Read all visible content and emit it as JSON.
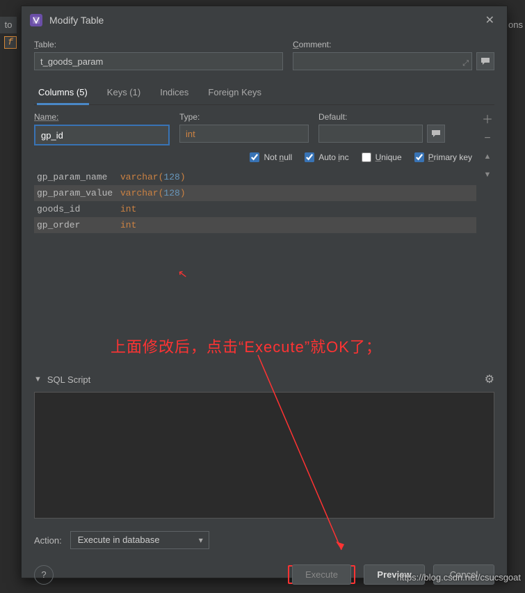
{
  "window": {
    "title": "Modify Table"
  },
  "table": {
    "label": "Table:",
    "value": "t_goods_param"
  },
  "comment": {
    "label": "Comment:",
    "value": ""
  },
  "tabs": {
    "columns": "Columns (5)",
    "keys": "Keys (1)",
    "indices": "Indices",
    "foreign": "Foreign Keys"
  },
  "column_fields": {
    "name_label": "Name:",
    "name_value": "gp_id",
    "type_label": "Type:",
    "type_value": "int",
    "default_label": "Default:",
    "default_value": ""
  },
  "checks": {
    "not_null": "Not null",
    "auto_inc": "Auto inc",
    "unique": "Unique",
    "primary_key": "Primary key"
  },
  "columns_list": [
    {
      "name": "gp_param_name",
      "type": "varchar",
      "size": "128"
    },
    {
      "name": "gp_param_value",
      "type": "varchar",
      "size": "128"
    },
    {
      "name": "goods_id",
      "type": "int",
      "size": ""
    },
    {
      "name": "gp_order",
      "type": "int",
      "size": ""
    }
  ],
  "annotation": "上面修改后，点击“Execute”就OK了；",
  "sql": {
    "header": "SQL Script",
    "body": ""
  },
  "action": {
    "label": "Action:",
    "selected": "Execute in database"
  },
  "buttons": {
    "execute": "Execute",
    "preview": "Preview",
    "cancel": "Cancel"
  },
  "watermark": "https://blog.csdn.net/csucsgoat",
  "back_left": "to",
  "back_right": "ons",
  "sidebar_icon": "f"
}
